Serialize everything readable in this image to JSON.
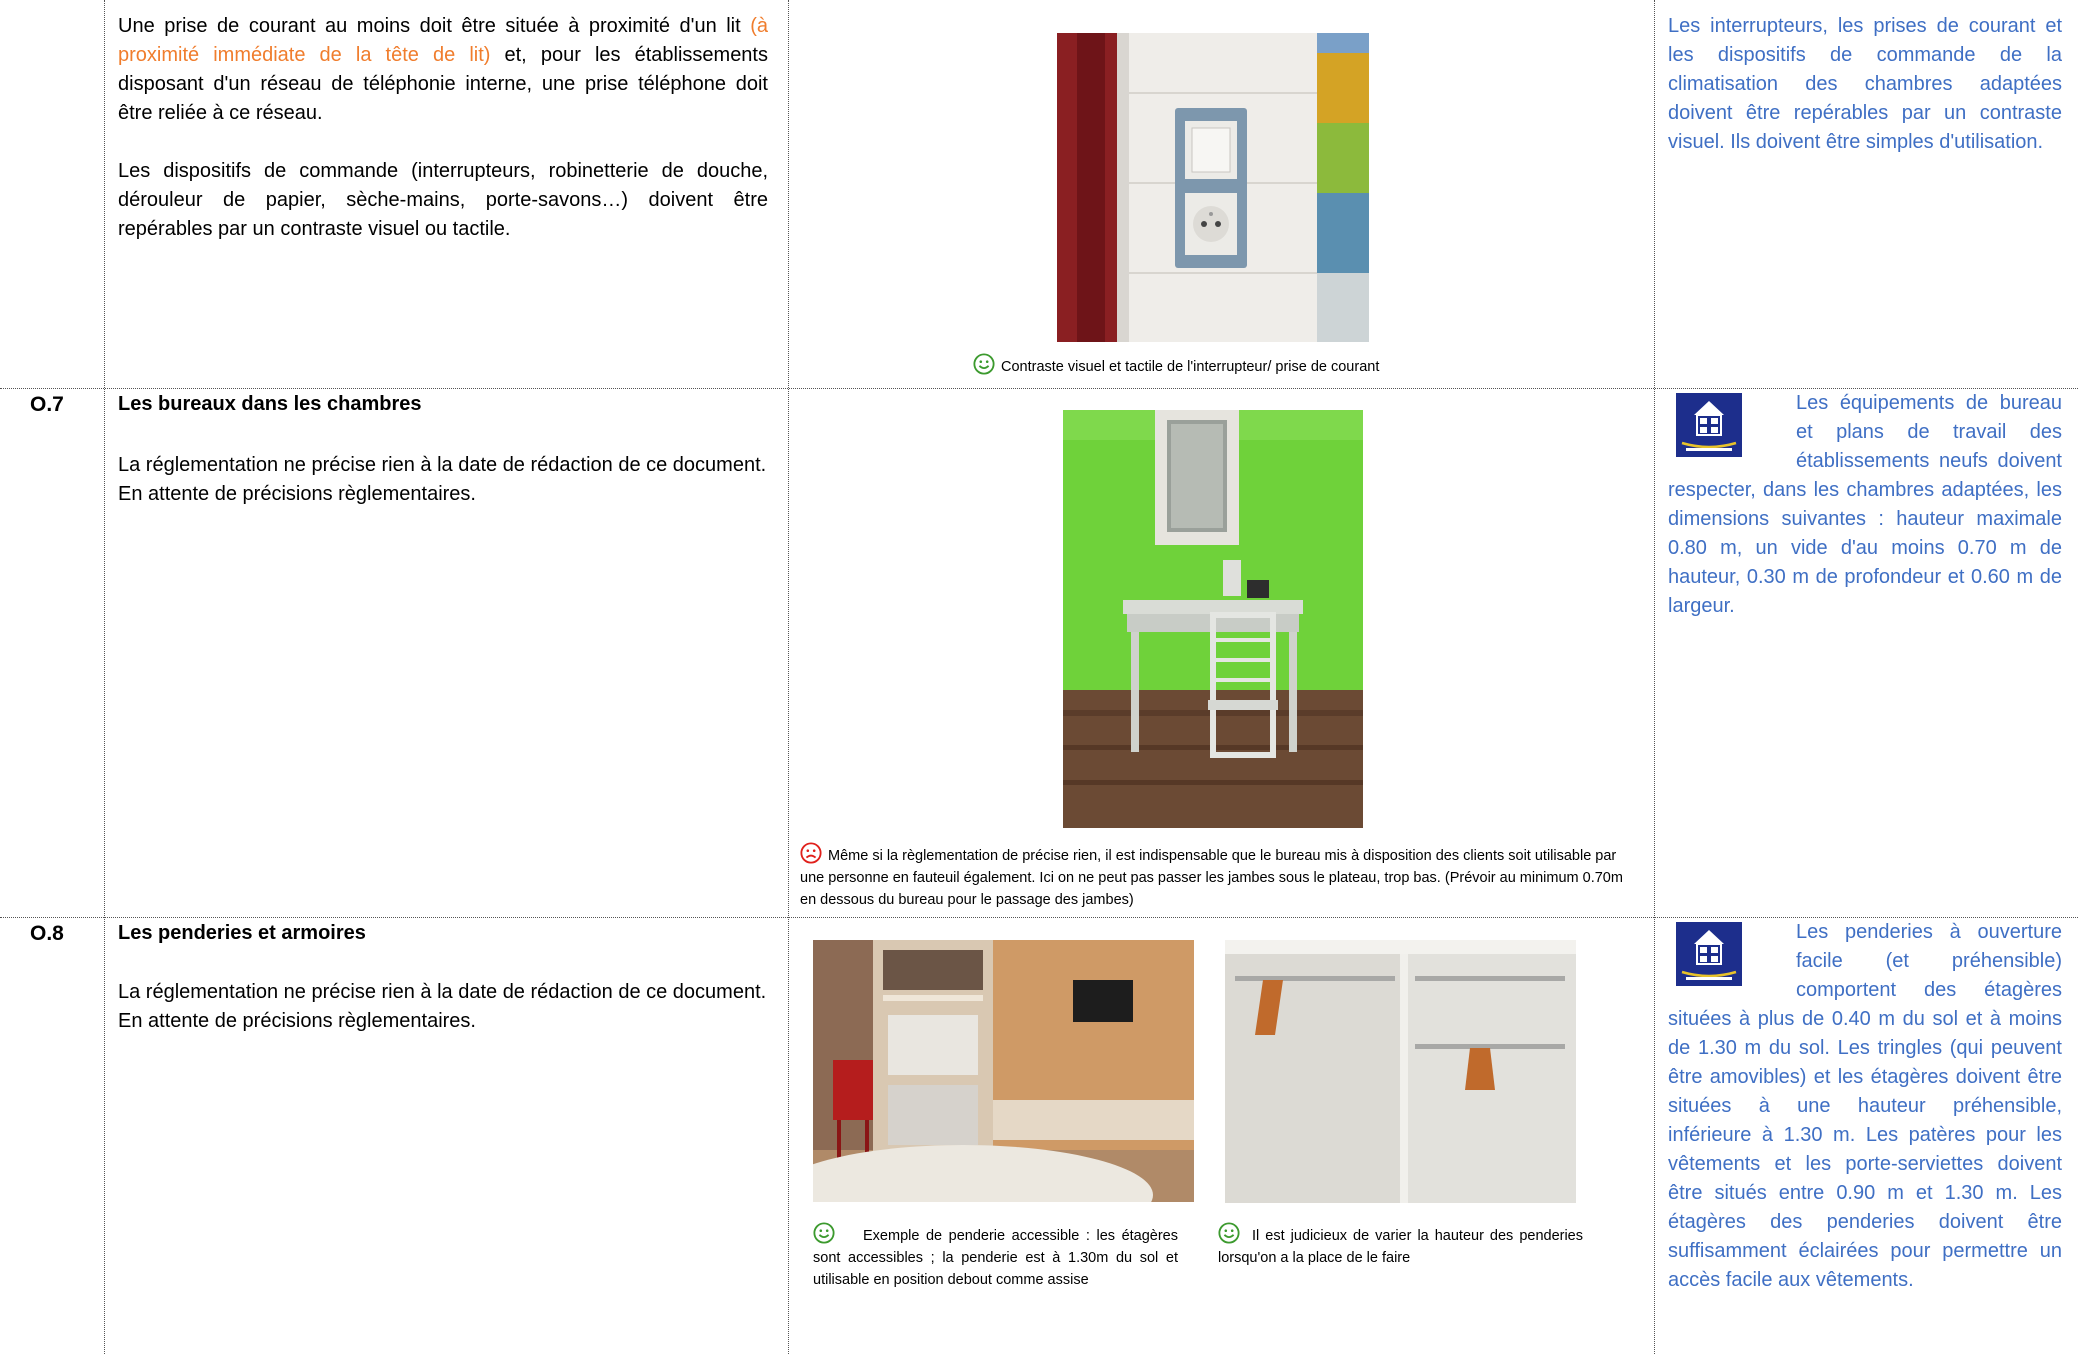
{
  "rows": [
    {
      "code": "",
      "description": {
        "p1_before": "Une prise de courant au moins doit être située à proximité d'un lit ",
        "p1_highlight": "(à proximité immédiate de la tête de lit)",
        "p1_after": " et, pour les établissements disposant d'un réseau de téléphonie interne, une prise téléphone doit être reliée à ce réseau.",
        "p2": "Les dispositifs de commande (interrupteurs, robinetterie de douche, dérouleur de papier, sèche-mains, porte-savons…) doivent être repérables par un contraste visuel ou tactile."
      },
      "caption": "Contraste visuel et tactile de l'interrupteur/ prise de courant",
      "caption_icon": "smiley-happy-icon",
      "recommendation": "Les interrupteurs, les prises de courant et les dispositifs de commande de la climatisation des chambres adaptées doivent être repérables par un contraste visuel. Ils doivent être simples d'utilisation."
    },
    {
      "code": "O.7",
      "title": "Les bureaux dans les chambres",
      "description": {
        "line1": "La réglementation ne précise rien à la date de rédaction de ce document.",
        "line2": "En attente de précisions règlementaires."
      },
      "caption": "Même si la règlementation de précise rien, il est indispensable que le bureau mis à disposition des clients soit utilisable par une personne en fauteuil également. Ici on ne peut pas passer les jambes sous le plateau, trop bas. (Prévoir au minimum 0.70m en dessous du bureau pour le passage des jambes)",
      "caption_icon": "smiley-sad-icon",
      "recommendation": "Les équipements de bureau et plans de travail des établissements neufs doivent respecter, dans les chambres adaptées, les dimensions suivantes : hauteur maximale 0.80 m, un vide d'au moins 0.70 m de hauteur, 0.30 m de profondeur et 0.60 m de largeur."
    },
    {
      "code": "O.8",
      "title": "Les penderies et armoires",
      "description": {
        "line1": "La réglementation ne précise rien à la date de rédaction de ce document.",
        "line2": "En attente de précisions règlementaires."
      },
      "caption_left": "Exemple de penderie accessible : les étagères sont accessibles ; la penderie est à 1.30m du sol et utilisable en position debout comme assise",
      "caption_right": "Il est judicieux de varier la hauteur des penderies lorsqu'on a la place de le faire",
      "caption_icon": "smiley-happy-icon",
      "recommendation": "Les penderies à ouverture facile (et préhensible) comportent des étagères situées à plus de 0.40 m du sol et à moins de 1.30 m du sol. Les tringles (qui peuvent être amovibles) et les étagères doivent être situées à une hauteur préhensible, inférieure à 1.30 m. Les patères pour les vêtements et les porte-serviettes doivent être situés entre 0.90 m et 1.30 m. Les étagères des penderies doivent être suffisamment éclairées pour permettre un accès facile aux vêtements."
    }
  ],
  "colors": {
    "highlight": "#f07d2d",
    "recommendation": "#3f6fc4",
    "happy": "#3c9a2e",
    "sad": "#e0201b"
  }
}
